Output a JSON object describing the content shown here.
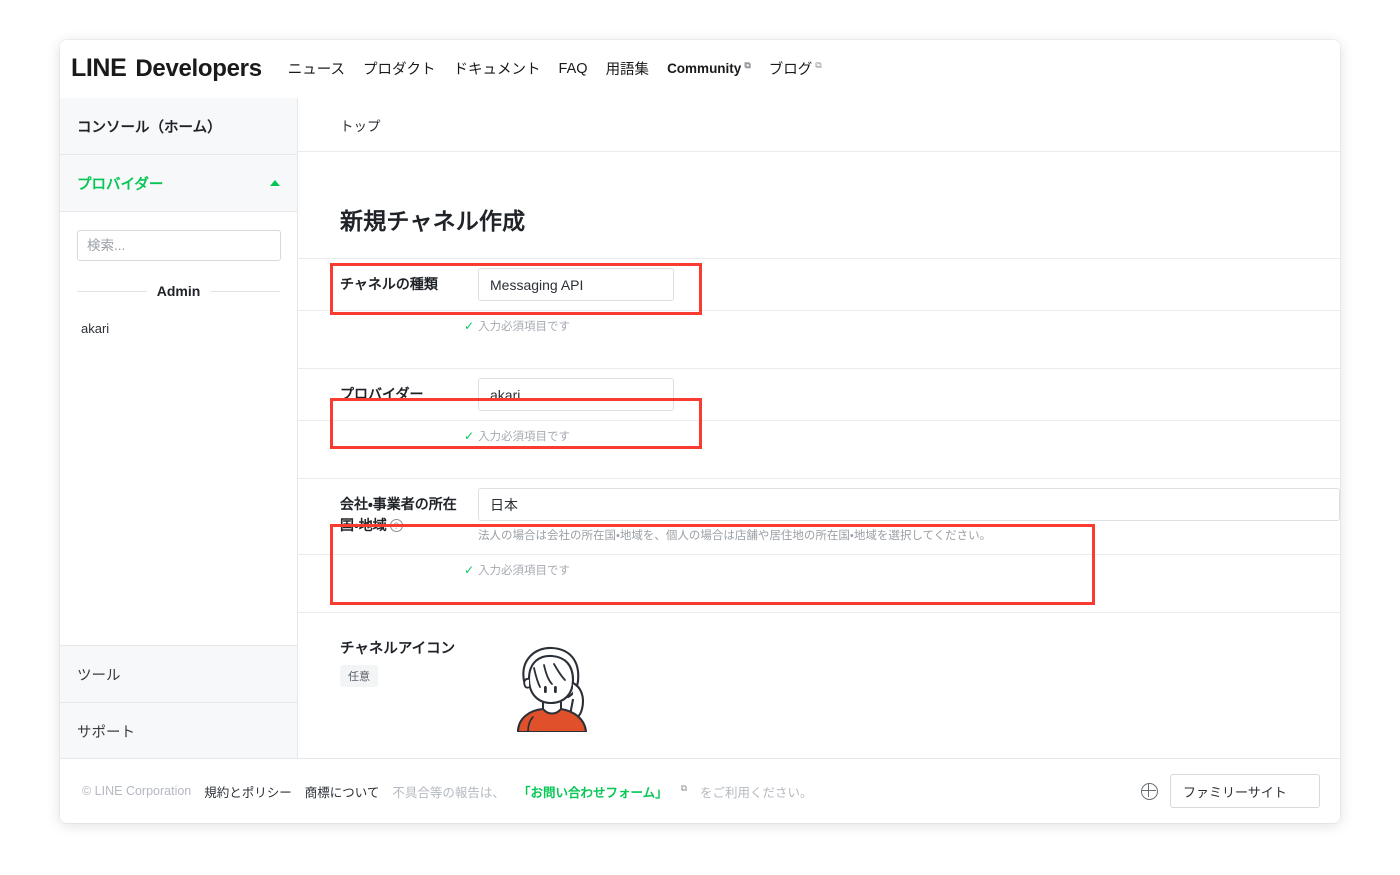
{
  "topnav": {
    "brand_primary": "LINE",
    "brand_secondary": "Developers",
    "links": [
      {
        "label": "ニュース",
        "external": false
      },
      {
        "label": "プロダクト",
        "external": false
      },
      {
        "label": "ドキュメント",
        "external": false
      },
      {
        "label": "FAQ",
        "external": false
      },
      {
        "label": "用語集",
        "external": false
      },
      {
        "label": "Community",
        "external": true
      },
      {
        "label": "ブログ",
        "external": true
      }
    ],
    "external_glyph": "⧉"
  },
  "sidebar": {
    "console_home": "コンソール（ホーム）",
    "provider_section": "プロバイダー",
    "search_placeholder": "検索...",
    "search_value": "",
    "group_label": "Admin",
    "providers": [
      {
        "name": "akari"
      }
    ],
    "tools": "ツール",
    "support": "サポート"
  },
  "main": {
    "breadcrumb": "トップ",
    "page_title": "新規チャネル作成",
    "required_note": "入力必須項目です",
    "check_glyph": "✓",
    "fields": [
      {
        "label": "チャネルの種類",
        "value": "Messaging API",
        "help": "",
        "note": "入力必須項目です"
      },
      {
        "label": "プロバイダー",
        "value": "akari",
        "help": "",
        "note": "入力必須項目です"
      },
      {
        "label_line1": "会社・事業者の所在",
        "label_line2": "国・地域",
        "value": "日本",
        "help": "法人の場合は会社の所在国・地域を、個人の場合は店舗や居住地の所在国・地域を選択してください。",
        "note": "入力必須項目です",
        "has_tooltip": true,
        "tooltip_glyph": "?"
      }
    ],
    "channel_icon": {
      "title": "チャネルアイコン",
      "optional_badge": "任意"
    }
  },
  "footer": {
    "copyright": "© LINE Corporation",
    "terms": "規約とポリシー",
    "trademark": "商標について",
    "report_prefix": "不具合等の報告は、",
    "contact_form": "「お問い合わせフォーム」",
    "report_suffix": "をご利用ください。",
    "external_glyph": "⧉",
    "family_site": "ファミリーサイト"
  },
  "colors": {
    "accent_green": "#06c755",
    "highlight_red": "#f93b30",
    "text_primary": "#1f2328",
    "text_muted": "#9aa0a6",
    "border": "#e6e8eb",
    "sidebar_bg": "#f7f8fa",
    "avatar_shirt": "#e0512b"
  }
}
